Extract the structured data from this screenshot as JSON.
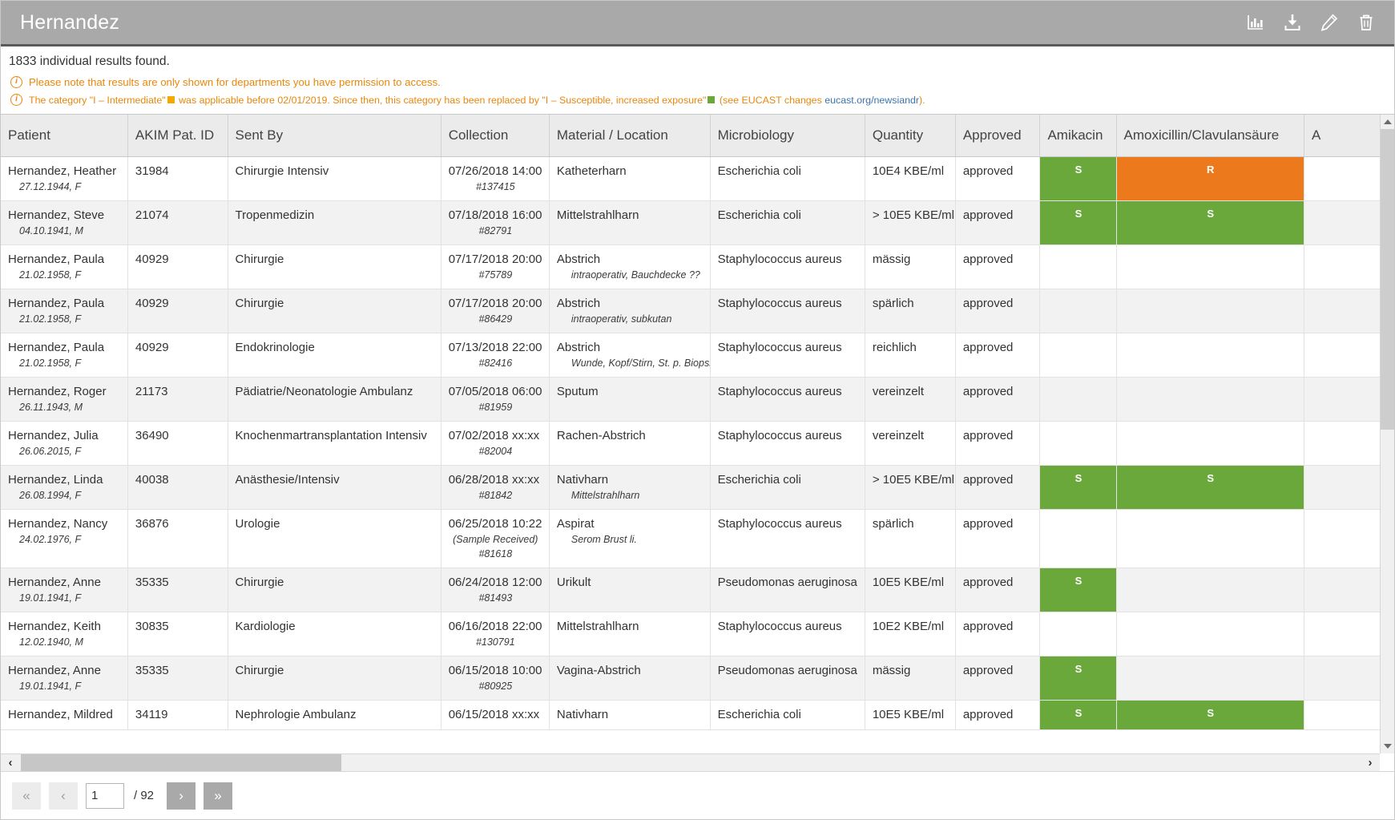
{
  "titlebar": {
    "title": "Hernandez",
    "actions": [
      {
        "name": "chart-icon",
        "label": "Statistics"
      },
      {
        "name": "download-icon",
        "label": "Download"
      },
      {
        "name": "edit-icon",
        "label": "Edit"
      },
      {
        "name": "trash-icon",
        "label": "Delete"
      }
    ]
  },
  "notices": {
    "results_count": "1833 individual results found.",
    "permission_notice": "Please note that results are only shown for departments you have permission to access.",
    "eucast": {
      "part1": "The category \"I – Intermediate\"",
      "part2": " was applicable before 02/01/2019. Since then, this category has been replaced by \"I – Susceptible, increased exposure\"",
      "part3": " (see EUCAST changes ",
      "link": "eucast.org/newsiandr",
      "part4": ")."
    },
    "colors": {
      "intermediate": "#f5a800",
      "susceptible": "#6aa83c",
      "resistant": "#ec7a1c",
      "notice_text": "#e8870b",
      "link": "#3b73af"
    }
  },
  "table": {
    "columns": [
      "Patient",
      "AKIM Pat. ID",
      "Sent By",
      "Collection",
      "Material / Location",
      "Microbiology",
      "Quantity",
      "Approved",
      "Amikacin",
      "Amoxicillin/Clavulansäure",
      "A"
    ],
    "rows": [
      {
        "patient": "Hernandez, Heather",
        "dob": "27.12.1944, F",
        "akim": "31984",
        "sentby": "Chirurgie Intensiv",
        "collection": "07/26/2018 14:00",
        "collection_note": "",
        "sample_id": "#137415",
        "material": "Katheterharn",
        "location": "",
        "micro": "Escherichia coli",
        "quantity": "10E4 KBE/ml",
        "approved": "approved",
        "amikacin": "S",
        "amoxiclav": "R"
      },
      {
        "patient": "Hernandez, Steve",
        "dob": "04.10.1941, M",
        "akim": "21074",
        "sentby": "Tropenmedizin",
        "collection": "07/18/2018 16:00",
        "collection_note": "",
        "sample_id": "#82791",
        "material": "Mittelstrahlharn",
        "location": "",
        "micro": "Escherichia coli",
        "quantity": "> 10E5 KBE/ml",
        "approved": "approved",
        "amikacin": "S",
        "amoxiclav": "S"
      },
      {
        "patient": "Hernandez, Paula",
        "dob": "21.02.1958, F",
        "akim": "40929",
        "sentby": "Chirurgie",
        "collection": "07/17/2018 20:00",
        "collection_note": "",
        "sample_id": "#75789",
        "material": "Abstrich",
        "location": "intraoperativ, Bauchdecke ??",
        "micro": "Staphylococcus aureus",
        "quantity": "mässig",
        "approved": "approved",
        "amikacin": "",
        "amoxiclav": ""
      },
      {
        "patient": "Hernandez, Paula",
        "dob": "21.02.1958, F",
        "akim": "40929",
        "sentby": "Chirurgie",
        "collection": "07/17/2018 20:00",
        "collection_note": "",
        "sample_id": "#86429",
        "material": "Abstrich",
        "location": "intraoperativ, subkutan",
        "micro": "Staphylococcus aureus",
        "quantity": "spärlich",
        "approved": "approved",
        "amikacin": "",
        "amoxiclav": ""
      },
      {
        "patient": "Hernandez, Paula",
        "dob": "21.02.1958, F",
        "akim": "40929",
        "sentby": "Endokrinologie",
        "collection": "07/13/2018 22:00",
        "collection_note": "",
        "sample_id": "#82416",
        "material": "Abstrich",
        "location": "Wunde, Kopf/Stirn, St. p. Biopsie",
        "micro": "Staphylococcus aureus",
        "quantity": "reichlich",
        "approved": "approved",
        "amikacin": "",
        "amoxiclav": ""
      },
      {
        "patient": "Hernandez, Roger",
        "dob": "26.11.1943, M",
        "akim": "21173",
        "sentby": "Pädiatrie/Neonatologie Ambulanz",
        "collection": "07/05/2018 06:00",
        "collection_note": "",
        "sample_id": "#81959",
        "material": "Sputum",
        "location": "",
        "micro": "Staphylococcus aureus",
        "quantity": "vereinzelt",
        "approved": "approved",
        "amikacin": "",
        "amoxiclav": ""
      },
      {
        "patient": "Hernandez, Julia",
        "dob": "26.06.2015, F",
        "akim": "36490",
        "sentby": "Knochenmartransplantation Intensiv",
        "collection": "07/02/2018 xx:xx",
        "collection_note": "",
        "sample_id": "#82004",
        "material": "Rachen-Abstrich",
        "location": "",
        "micro": "Staphylococcus aureus",
        "quantity": "vereinzelt",
        "approved": "approved",
        "amikacin": "",
        "amoxiclav": ""
      },
      {
        "patient": "Hernandez, Linda",
        "dob": "26.08.1994, F",
        "akim": "40038",
        "sentby": "Anästhesie/Intensiv",
        "collection": "06/28/2018 xx:xx",
        "collection_note": "",
        "sample_id": "#81842",
        "material": "Nativharn",
        "location": "Mittelstrahlharn",
        "micro": "Escherichia coli",
        "quantity": "> 10E5 KBE/ml",
        "approved": "approved",
        "amikacin": "S",
        "amoxiclav": "S"
      },
      {
        "patient": "Hernandez, Nancy",
        "dob": "24.02.1976, F",
        "akim": "36876",
        "sentby": "Urologie",
        "collection": "06/25/2018 10:22",
        "collection_note": "(Sample Received)",
        "sample_id": "#81618",
        "material": "Aspirat",
        "location": "Serom Brust li.",
        "micro": "Staphylococcus aureus",
        "quantity": "spärlich",
        "approved": "approved",
        "amikacin": "",
        "amoxiclav": ""
      },
      {
        "patient": "Hernandez, Anne",
        "dob": "19.01.1941, F",
        "akim": "35335",
        "sentby": "Chirurgie",
        "collection": "06/24/2018 12:00",
        "collection_note": "",
        "sample_id": "#81493",
        "material": "Urikult",
        "location": "",
        "micro": "Pseudomonas aeruginosa",
        "quantity": "10E5 KBE/ml",
        "approved": "approved",
        "amikacin": "S",
        "amoxiclav": ""
      },
      {
        "patient": "Hernandez, Keith",
        "dob": "12.02.1940, M",
        "akim": "30835",
        "sentby": "Kardiologie",
        "collection": "06/16/2018 22:00",
        "collection_note": "",
        "sample_id": "#130791",
        "material": "Mittelstrahlharn",
        "location": "",
        "micro": "Staphylococcus aureus",
        "quantity": "10E2 KBE/ml",
        "approved": "approved",
        "amikacin": "",
        "amoxiclav": ""
      },
      {
        "patient": "Hernandez, Anne",
        "dob": "19.01.1941, F",
        "akim": "35335",
        "sentby": "Chirurgie",
        "collection": "06/15/2018 10:00",
        "collection_note": "",
        "sample_id": "#80925",
        "material": "Vagina-Abstrich",
        "location": "",
        "micro": "Pseudomonas aeruginosa",
        "quantity": "mässig",
        "approved": "approved",
        "amikacin": "S",
        "amoxiclav": ""
      },
      {
        "patient": "Hernandez, Mildred",
        "dob": "",
        "akim": "34119",
        "sentby": "Nephrologie Ambulanz",
        "collection": "06/15/2018 xx:xx",
        "collection_note": "",
        "sample_id": "",
        "material": "Nativharn",
        "location": "",
        "micro": "Escherichia coli",
        "quantity": "10E5 KBE/ml",
        "approved": "approved",
        "amikacin": "S",
        "amoxiclav": "S"
      }
    ]
  },
  "pager": {
    "first_label": "«",
    "prev_label": "‹",
    "page_value": "1",
    "total_label": "/ 92",
    "next_label": "›",
    "last_label": "»"
  }
}
